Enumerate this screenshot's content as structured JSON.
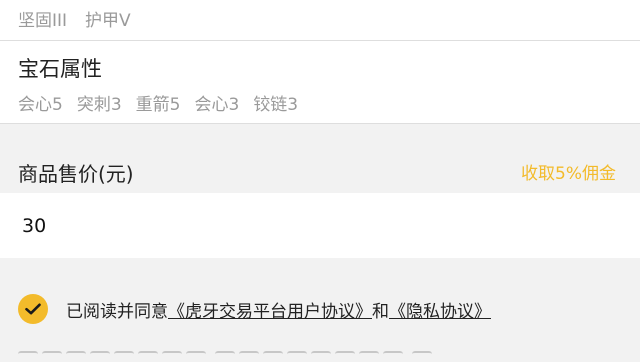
{
  "top_skills": [
    "坚固III",
    "护甲V"
  ],
  "gem_section": {
    "title": "宝石属性",
    "attributes": [
      "会心5",
      "突刺3",
      "重箭5",
      "会心3",
      "铰链3"
    ]
  },
  "price": {
    "label": "商品售价(元)",
    "fee_note": "收取5%佣金",
    "value": "30"
  },
  "agreement": {
    "checked": true,
    "prefix": "已阅读并同意",
    "link1": "《虎牙交易平台用户协议》",
    "middle": "和",
    "link2": "《隐私协议》"
  },
  "colors": {
    "accent": "#f3bb2b",
    "muted_text": "#9a9a9a",
    "background": "#f2f2f2"
  },
  "icons": {
    "checkbox": "check-icon"
  }
}
